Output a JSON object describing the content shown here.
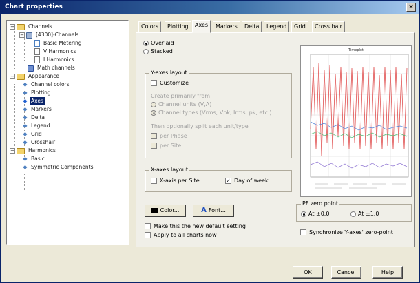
{
  "window": {
    "title": "Chart properties",
    "close_glyph": "×"
  },
  "tree": {
    "items": [
      {
        "label": "Channels",
        "toggle": "−",
        "kind": "folder"
      },
      {
        "label": "[4300]-Channels",
        "toggle": "−",
        "kind": "device"
      },
      {
        "label": "Basic Metering",
        "kind": "check-doc"
      },
      {
        "label": "V Harmonics",
        "kind": "doc"
      },
      {
        "label": "I Harmonics",
        "kind": "doc"
      },
      {
        "label": "Math channels",
        "kind": "math"
      },
      {
        "label": "Appearance",
        "toggle": "−",
        "kind": "folder"
      },
      {
        "label": "Channel colors",
        "kind": "bullet"
      },
      {
        "label": "Plotting",
        "kind": "bullet"
      },
      {
        "label": "Axes",
        "kind": "bullet",
        "selected": true
      },
      {
        "label": "Markers",
        "kind": "bullet"
      },
      {
        "label": "Delta",
        "kind": "bullet"
      },
      {
        "label": "Legend",
        "kind": "bullet"
      },
      {
        "label": "Grid",
        "kind": "bullet"
      },
      {
        "label": "Crosshair",
        "kind": "bullet"
      },
      {
        "label": "Harmonics",
        "toggle": "−",
        "kind": "folder"
      },
      {
        "label": "Basic",
        "kind": "bullet"
      },
      {
        "label": "Symmetric Components",
        "kind": "bullet"
      }
    ]
  },
  "tabs": [
    "Colors",
    "Plotting",
    "Axes",
    "Markers",
    "Delta",
    "Legend",
    "Grid",
    "Cross hair"
  ],
  "active_tab": "Axes",
  "axes": {
    "overlaid": "Overlaid",
    "stacked": "Stacked",
    "y_layout_title": "Y-axes layout",
    "customize": "Customize",
    "create_primarily_from": "Create primarily from",
    "channel_units": "Channel units (V,A)",
    "channel_types": "Channel types (Vrms, Vpk, Irms, pk, etc.)",
    "then_optionally": "Then optionally split each unit/type",
    "per_phase": "per Phase",
    "per_site": "per Site",
    "x_layout_title": "X-axes layout",
    "x_axis_per_site": "X-axis per Site",
    "day_of_week": "Day of week",
    "color_btn": "Color...",
    "font_btn": "Font...",
    "font_glyph": "A",
    "make_default": "Make this the new default setting",
    "apply_all": "Apply to all charts now",
    "pf_zero_title": "PF zero point",
    "pf_at_0": "At ±0.0",
    "pf_at_1": "At ±1.0",
    "sync_y": "Synchronize Y-axes' zero-point"
  },
  "preview": {
    "title": "Timeplot"
  },
  "buttons": {
    "ok": "OK",
    "cancel": "Cancel",
    "help": "Help"
  },
  "colors": {
    "selection": "#0a246a",
    "title_bar": "#0a246a"
  }
}
